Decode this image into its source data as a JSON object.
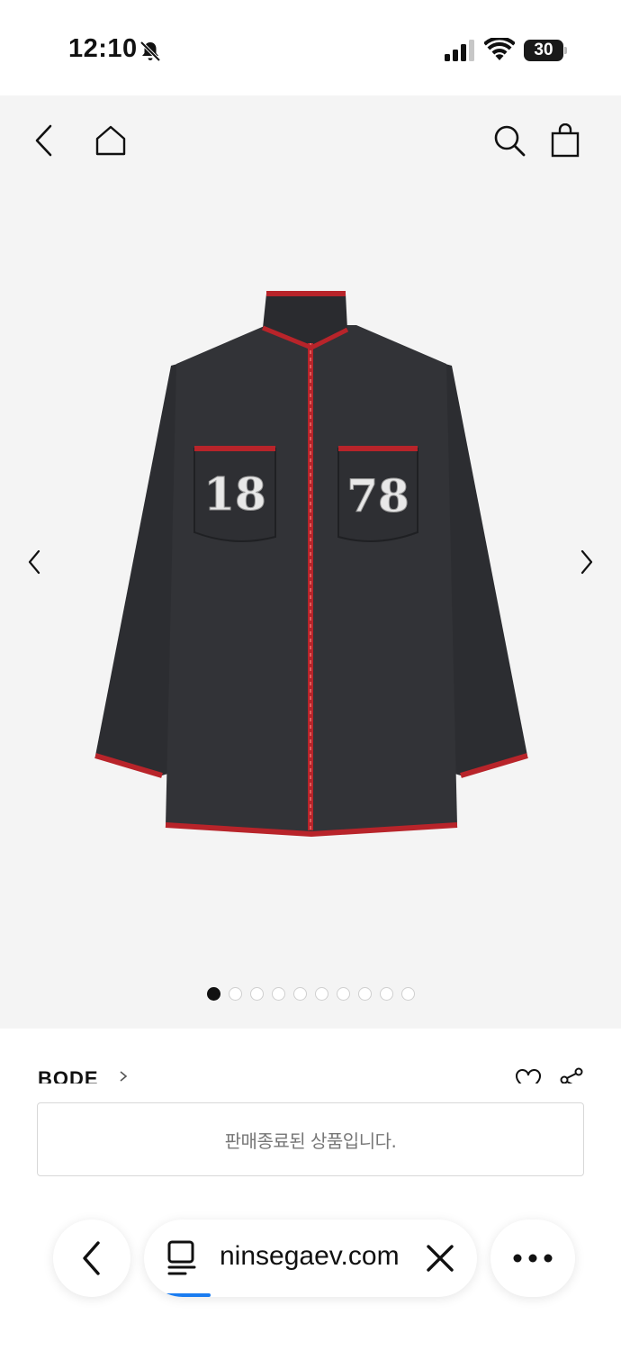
{
  "status_bar": {
    "time": "12:10",
    "battery": "30"
  },
  "gallery": {
    "jacket_numbers": [
      "18",
      "78"
    ],
    "dots": [
      true,
      false,
      false,
      false,
      false,
      false,
      false,
      false,
      false,
      false
    ]
  },
  "product": {
    "brand": "BODE",
    "sold_out": "판매종료된 상품입니다."
  },
  "browser": {
    "url": "ninsegaev.com"
  },
  "icons": {
    "back": "chevron-left-icon",
    "home": "home-icon",
    "search": "search-icon",
    "bag": "shopping-bag-icon",
    "heart": "heart-icon",
    "share": "share-icon"
  },
  "colors": {
    "gallery_bg": "#f4f4f4",
    "jacket": "#2e2f33",
    "stitch": "#b8242a",
    "accent_blue": "#1a7cf0"
  }
}
